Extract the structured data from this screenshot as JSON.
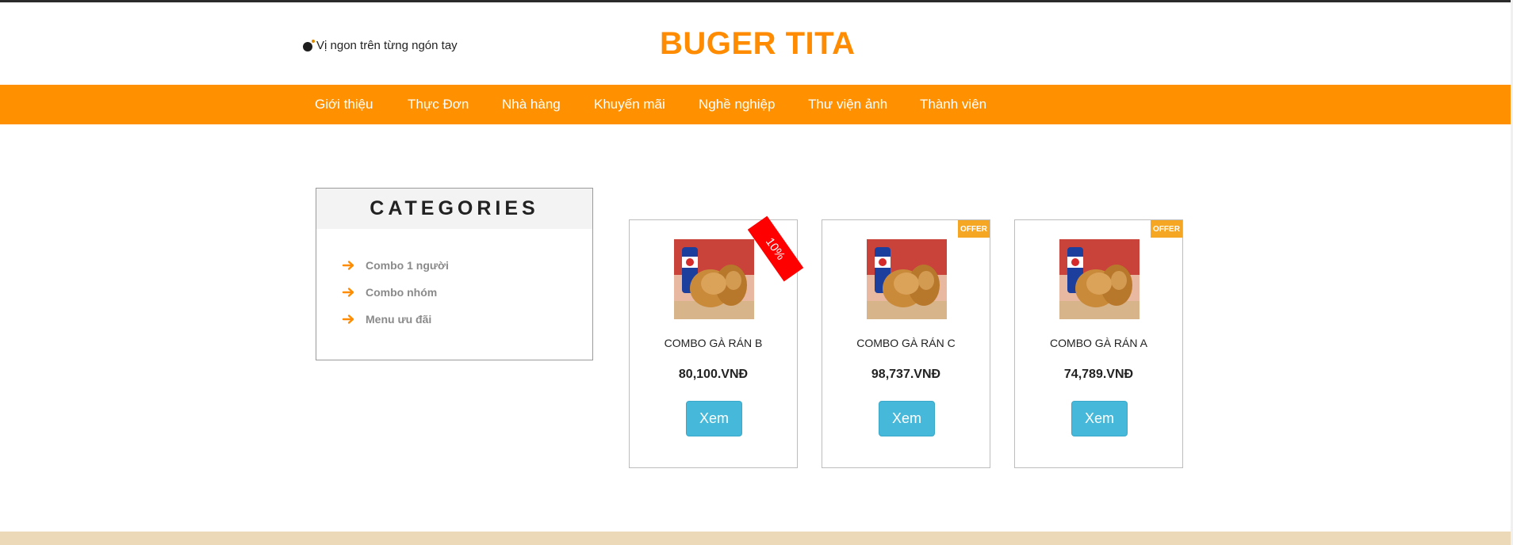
{
  "header": {
    "tagline": "Vị ngon trên từng ngón tay",
    "brand": "BUGER TITA"
  },
  "nav": {
    "items": [
      {
        "label": "Giới thiệu"
      },
      {
        "label": "Thực Đơn"
      },
      {
        "label": "Nhà hàng"
      },
      {
        "label": "Khuyến mãi"
      },
      {
        "label": "Nghề nghiệp"
      },
      {
        "label": "Thư viện ảnh"
      },
      {
        "label": "Thành viên"
      }
    ]
  },
  "categories": {
    "title": "CATEGORIES",
    "items": [
      {
        "label": "Combo 1 người"
      },
      {
        "label": "Combo nhóm"
      },
      {
        "label": "Menu ưu đãi"
      }
    ]
  },
  "products": [
    {
      "name": "COMBO GÀ RÁN B",
      "price": "80,100.VNĐ",
      "button": "Xem",
      "badge": "10%"
    },
    {
      "name": "COMBO GÀ RÁN C",
      "price": "98,737.VNĐ",
      "button": "Xem",
      "badge": "OFFER"
    },
    {
      "name": "COMBO GÀ RÁN A",
      "price": "74,789.VNĐ",
      "button": "Xem",
      "badge": "OFFER"
    }
  ],
  "colors": {
    "brand": "#ff8c00",
    "navbar": "#ff9100",
    "button": "#46b8da",
    "offer": "#f5a623",
    "discount": "#ff0000",
    "footer": "#ecd9b7"
  }
}
